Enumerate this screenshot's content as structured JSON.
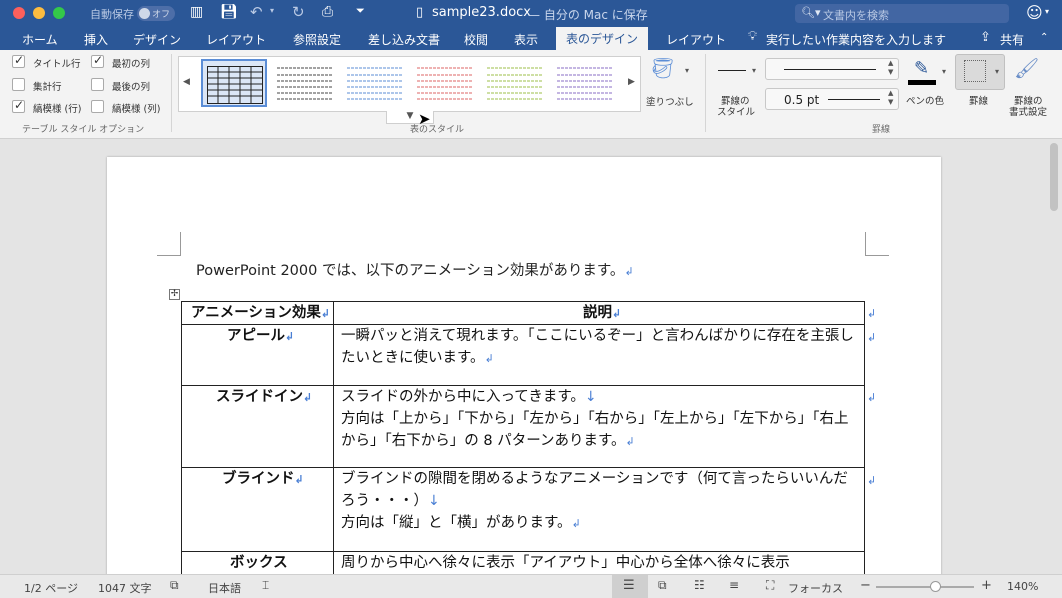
{
  "window": {
    "autosave_label": "自動保存",
    "autosave_state": "オフ",
    "doc_title": "sample23.docx",
    "title_suffix": "— 自分の Mac に保存",
    "search_placeholder": "文書内を検索"
  },
  "tabs": [
    {
      "label": "ホーム"
    },
    {
      "label": "挿入"
    },
    {
      "label": "デザイン"
    },
    {
      "label": "レイアウト"
    },
    {
      "label": "参照設定"
    },
    {
      "label": "差し込み文書"
    },
    {
      "label": "校閲"
    },
    {
      "label": "表示"
    },
    {
      "label": "表のデザイン"
    },
    {
      "label": "レイアウト"
    }
  ],
  "active_tab": "表のデザイン",
  "tell_me": "実行したい作業内容を入力します",
  "share_label": "共有",
  "ribbon": {
    "options": [
      {
        "label": "タイトル行",
        "checked": true
      },
      {
        "label": "最初の列",
        "checked": true
      },
      {
        "label": "集計行",
        "checked": false
      },
      {
        "label": "最後の列",
        "checked": false
      },
      {
        "label": "縞模様 (行)",
        "checked": true
      },
      {
        "label": "縞模様 (列)",
        "checked": false
      }
    ],
    "options_group_label": "テーブル スタイル オプション",
    "styles_group_label": "表のスタイル",
    "shading_label": "塗りつぶし",
    "border_style_label_1": "罫線の",
    "border_style_label_2": "スタイル",
    "pen_weight": "0.5 pt",
    "pen_color_label": "ペンの色",
    "borders_label": "罫線",
    "border_painter_label_1": "罫線の",
    "border_painter_label_2": "書式設定",
    "borders_group_label": "罫線",
    "colors": {
      "accent": "#2b5797",
      "pen": "#000000"
    }
  },
  "document": {
    "intro": "PowerPoint 2000 では、以下のアニメーション効果があります。",
    "header": [
      "アニメーション効果",
      "説明"
    ],
    "rows": [
      {
        "effect": "アピール",
        "lines": [
          "一瞬パッと消えて現れます。「ここにいるぞー」と言わんばかりに存在を主張したいときに使います。"
        ]
      },
      {
        "effect": "スライドイン",
        "lines": [
          "スライドの外から中に入ってきます。",
          "方向は「上から」「下から」「左から」「右から」「左上から」「左下から」「右上から」「右下から」の 8 パターンあります。"
        ]
      },
      {
        "effect": "ブラインド",
        "lines": [
          "ブラインドの隙間を閉めるようなアニメーションです（何て言ったらいいんだろう・・・）",
          "方向は「縦」と「横」があります。"
        ]
      },
      {
        "effect": "ボックス",
        "lines": [
          "周りから中心へ徐々に表示「アイアウト」中心から全体へ徐々に表示"
        ]
      }
    ]
  },
  "status": {
    "page": "1/2 ページ",
    "words": "1047 文字",
    "language": "日本語",
    "focus": "フォーカス",
    "zoom": "140%",
    "zoom_fraction": 0.6
  }
}
